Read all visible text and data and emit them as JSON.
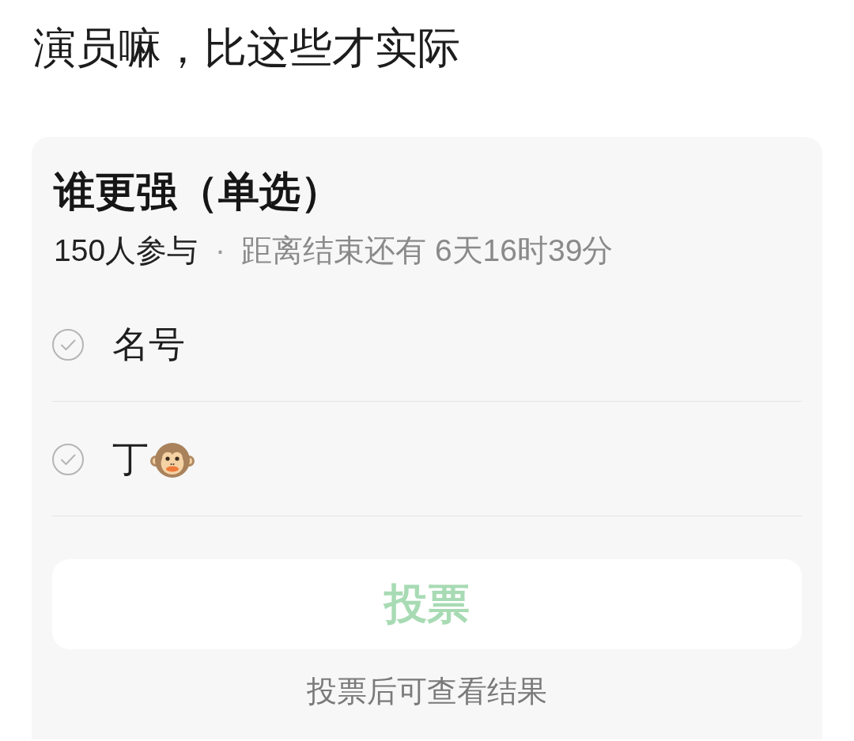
{
  "post": {
    "text": "演员嘛，比这些才实际"
  },
  "poll": {
    "title": "谁更强（单选）",
    "participants": "150人参与",
    "separator": "·",
    "deadline": "距离结束还有 6天16时39分",
    "options": [
      {
        "kind": "text",
        "label": "名号",
        "selected": false
      },
      {
        "kind": "emoji",
        "label": "丁",
        "selected": false
      }
    ],
    "vote_button": {
      "label": "投票",
      "disabled": true
    },
    "hint": "投票后可查看结果"
  }
}
